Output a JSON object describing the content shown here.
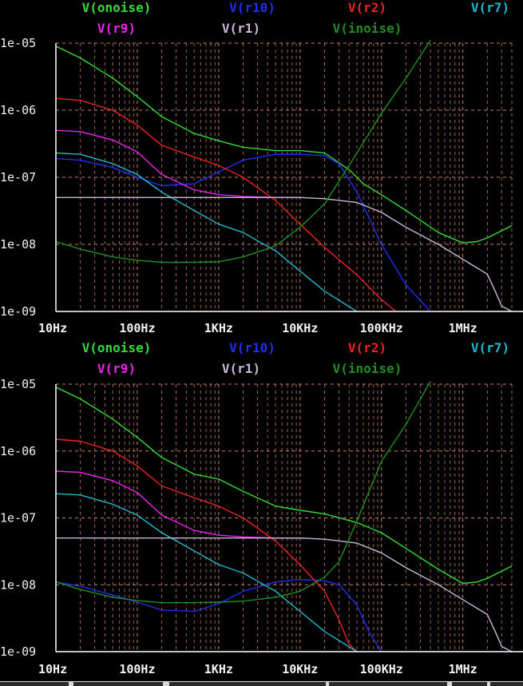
{
  "chart_data": [
    {
      "type": "line",
      "xscale": "log",
      "yscale": "log",
      "xlim": [
        10,
        4000000
      ],
      "ylim": [
        1e-09,
        1e-05
      ],
      "xticks": [
        "10Hz",
        "100Hz",
        "1KHz",
        "10KHz",
        "100KHz",
        "1MHz"
      ],
      "yticks": [
        "1e-05",
        "1e-06",
        "1e-07",
        "1e-08",
        "1e-09"
      ],
      "grid": true,
      "legend_position": "top",
      "series": [
        {
          "name": "V(onoise)",
          "color": "#33dd33",
          "x": [
            10,
            20,
            50,
            100,
            200,
            500,
            1000,
            2000,
            5000,
            10000,
            20000,
            40000,
            60000,
            100000,
            200000,
            500000,
            1000000,
            1500000,
            2000000,
            4000000
          ],
          "y": [
            9e-06,
            6e-06,
            3e-06,
            1.6e-06,
            8e-07,
            4.5e-07,
            3.5e-07,
            2.8e-07,
            2.5e-07,
            2.5e-07,
            2.3e-07,
            1.3e-07,
            8e-08,
            5.5e-08,
            3.2e-08,
            1.5e-08,
            1.05e-08,
            1.1e-08,
            1.25e-08,
            1.9e-08
          ]
        },
        {
          "name": "V(r10)",
          "color": "#1f2ff0",
          "x": [
            10,
            20,
            50,
            100,
            200,
            500,
            1000,
            2000,
            5000,
            10000,
            20000,
            30000,
            50000,
            100000,
            200000,
            400000
          ],
          "y": [
            1.9e-07,
            1.8e-07,
            1.4e-07,
            1e-07,
            7.5e-08,
            8e-08,
            1.2e-07,
            1.8e-07,
            2.2e-07,
            2.2e-07,
            2.1e-07,
            1.6e-07,
            6e-08,
            1e-08,
            2.5e-09,
            9e-10
          ]
        },
        {
          "name": "V(r2)",
          "color": "#ee2222",
          "x": [
            10,
            20,
            50,
            100,
            200,
            500,
            1000,
            2000,
            5000,
            10000,
            20000,
            50000,
            100000,
            150000
          ],
          "y": [
            1.5e-06,
            1.4e-06,
            1e-06,
            6e-07,
            3e-07,
            2e-07,
            1.5e-07,
            1e-07,
            4.5e-08,
            2e-08,
            9e-09,
            3.5e-09,
            1.5e-09,
            9.5e-10
          ]
        },
        {
          "name": "V(r7)",
          "color": "#22b8cc",
          "x": [
            10,
            20,
            50,
            100,
            200,
            500,
            1000,
            2000,
            5000,
            10000,
            20000,
            50000
          ],
          "y": [
            2.3e-07,
            2.2e-07,
            1.6e-07,
            1.1e-07,
            6e-08,
            3.2e-08,
            2e-08,
            1.5e-08,
            8e-09,
            4e-09,
            2e-09,
            8.5e-10
          ]
        },
        {
          "name": "V(r9)",
          "color": "#ee22ee",
          "x": [
            10,
            20,
            50,
            100,
            200,
            500,
            1000,
            2000,
            5000,
            10000
          ],
          "y": [
            5e-07,
            4.8e-07,
            3.6e-07,
            2.4e-07,
            1.1e-07,
            6.5e-08,
            5.5e-08,
            5.2e-08,
            5e-08,
            5e-08
          ]
        },
        {
          "name": "V(r1)",
          "color": "#c8b8d8",
          "x": [
            10,
            100,
            1000,
            10000,
            20000,
            50000,
            100000,
            200000,
            500000,
            1000000,
            2000000,
            2500000,
            3000000,
            4000000
          ],
          "y": [
            5e-08,
            5e-08,
            5e-08,
            5e-08,
            4.8e-08,
            4.2e-08,
            3e-08,
            1.8e-08,
            1e-08,
            6e-09,
            3.6e-09,
            2e-09,
            1.2e-09,
            8.5e-10
          ]
        },
        {
          "name": "V(inoise)",
          "color": "#1f8f1f",
          "x": [
            10,
            20,
            50,
            100,
            200,
            500,
            1000,
            2000,
            5000,
            10000,
            20000,
            50000,
            100000,
            200000,
            400000
          ],
          "y": [
            1.1e-08,
            8.5e-09,
            6.5e-09,
            5.8e-09,
            5.4e-09,
            5.4e-09,
            5.5e-09,
            6.5e-09,
            9.5e-09,
            1.8e-08,
            4e-08,
            2.3e-07,
            9e-07,
            3e-06,
            1.1e-05
          ]
        }
      ]
    },
    {
      "type": "line",
      "xscale": "log",
      "yscale": "log",
      "xlim": [
        10,
        4000000
      ],
      "ylim": [
        1e-09,
        1e-05
      ],
      "xticks": [
        "10Hz",
        "100Hz",
        "1KHz",
        "10KHz",
        "100KHz",
        "1MHz"
      ],
      "yticks": [
        "1e-05",
        "1e-06",
        "1e-07",
        "1e-08",
        "1e-09"
      ],
      "grid": true,
      "legend_position": "top",
      "series": [
        {
          "name": "V(onoise)",
          "color": "#33dd33",
          "x": [
            10,
            20,
            50,
            100,
            200,
            500,
            1000,
            2000,
            5000,
            10000,
            20000,
            50000,
            100000,
            200000,
            500000,
            1000000,
            1500000,
            2000000,
            4000000
          ],
          "y": [
            9e-06,
            6e-06,
            3e-06,
            1.6e-06,
            8e-07,
            4.5e-07,
            3.8e-07,
            2.5e-07,
            1.5e-07,
            1.3e-07,
            1.15e-07,
            8.5e-08,
            6e-08,
            3.5e-08,
            1.7e-08,
            1.05e-08,
            1.1e-08,
            1.25e-08,
            1.9e-08
          ]
        },
        {
          "name": "V(r10)",
          "color": "#1f2ff0",
          "x": [
            10,
            20,
            50,
            100,
            200,
            500,
            1000,
            2000,
            5000,
            10000,
            20000,
            30000,
            50000,
            70000,
            100000
          ],
          "y": [
            1.1e-08,
            9.5e-09,
            7e-09,
            5.5e-09,
            4.2e-09,
            4e-09,
            5.2e-09,
            8e-09,
            1.1e-08,
            1.2e-08,
            1.15e-08,
            1e-08,
            5e-09,
            2e-09,
            9e-10
          ]
        },
        {
          "name": "V(r2)",
          "color": "#ee2222",
          "x": [
            10,
            20,
            50,
            100,
            200,
            500,
            1000,
            2000,
            5000,
            10000,
            20000,
            30000,
            40000,
            50000
          ],
          "y": [
            1.5e-06,
            1.4e-06,
            1e-06,
            6e-07,
            3e-07,
            2e-07,
            1.5e-07,
            1e-07,
            4.5e-08,
            2e-08,
            8e-09,
            3e-09,
            1.3e-09,
            8.5e-10
          ]
        },
        {
          "name": "V(r7)",
          "color": "#22b8cc",
          "x": [
            10,
            20,
            50,
            100,
            200,
            500,
            1000,
            2000,
            5000,
            10000,
            20000,
            50000
          ],
          "y": [
            2.3e-07,
            2.2e-07,
            1.6e-07,
            1.1e-07,
            6e-08,
            3.2e-08,
            2e-08,
            1.5e-08,
            8e-09,
            4e-09,
            2e-09,
            8.5e-10
          ]
        },
        {
          "name": "V(r9)",
          "color": "#ee22ee",
          "x": [
            10,
            20,
            50,
            100,
            200,
            500,
            1000,
            2000,
            5000,
            10000
          ],
          "y": [
            5e-07,
            4.8e-07,
            3.6e-07,
            2.4e-07,
            1.1e-07,
            6.5e-08,
            5.5e-08,
            5.2e-08,
            5e-08,
            5e-08
          ]
        },
        {
          "name": "V(r1)",
          "color": "#c8b8d8",
          "x": [
            10,
            100,
            1000,
            10000,
            20000,
            50000,
            100000,
            200000,
            500000,
            1000000,
            2000000,
            2500000,
            3000000,
            4000000
          ],
          "y": [
            5e-08,
            5e-08,
            5e-08,
            5e-08,
            4.8e-08,
            4.2e-08,
            3e-08,
            1.8e-08,
            1e-08,
            6e-09,
            3.6e-09,
            2e-09,
            1.2e-09,
            8.5e-10
          ]
        },
        {
          "name": "V(inoise)",
          "color": "#1f8f1f",
          "x": [
            10,
            20,
            50,
            100,
            200,
            500,
            1000,
            2000,
            5000,
            10000,
            20000,
            30000,
            50000,
            100000,
            200000,
            400000
          ],
          "y": [
            1.1e-08,
            8.5e-09,
            6.5e-09,
            5.8e-09,
            5.4e-09,
            5.4e-09,
            5.5e-09,
            5.7e-09,
            6.5e-09,
            8e-09,
            1.3e-08,
            2.2e-08,
            9e-08,
            7e-07,
            2.5e-06,
            1.1e-05
          ]
        }
      ]
    }
  ]
}
